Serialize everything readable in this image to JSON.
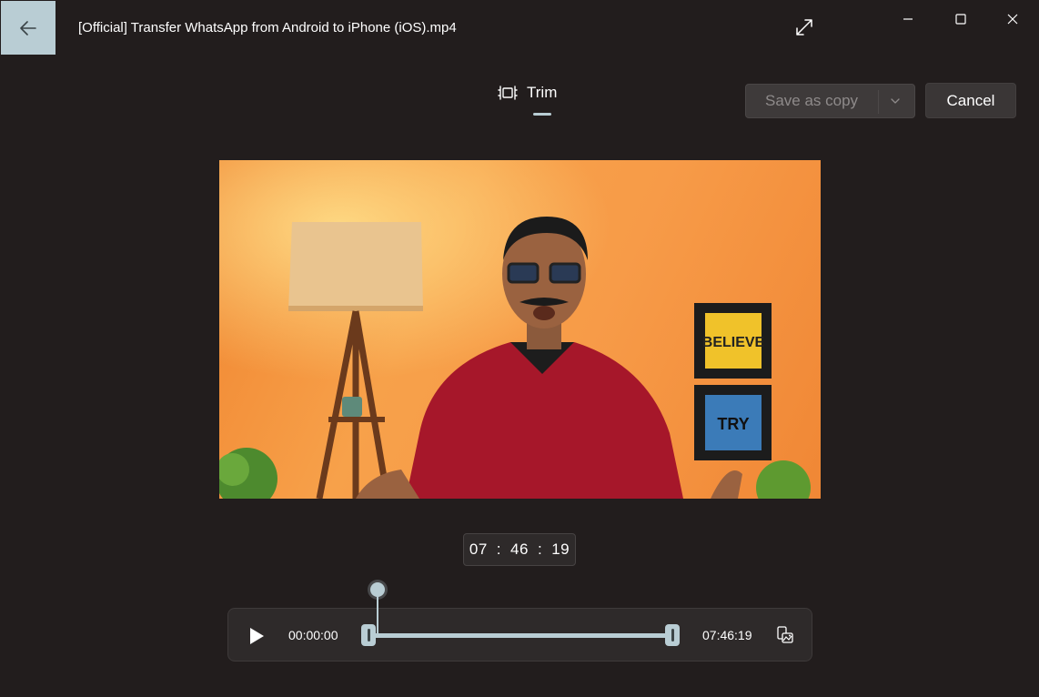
{
  "window": {
    "title": "[Official] Transfer WhatsApp from Android to iPhone (iOS).mp4",
    "accent_color": "#b9cdd4",
    "background_color": "#221d1d"
  },
  "titlebar_icons": {
    "back": "arrow-left-icon",
    "expand": "expand-arrows-icon",
    "minimize": "minimize-icon",
    "maximize": "maximize-icon",
    "close": "close-icon"
  },
  "toolbar": {
    "tab_trim_label": "Trim",
    "save_label": "Save as copy",
    "cancel_label": "Cancel"
  },
  "video_frame": {
    "sign_believe": "BELIEVE",
    "sign_try": "TRY"
  },
  "timecode": {
    "hours": "07",
    "minutes": "46",
    "seconds": "19",
    "separator": ":"
  },
  "player": {
    "start_time": "00:00:00",
    "end_time": "07:46:19",
    "trim_start_fraction": 0,
    "trim_end_fraction": 1,
    "playhead_fraction": 0
  }
}
